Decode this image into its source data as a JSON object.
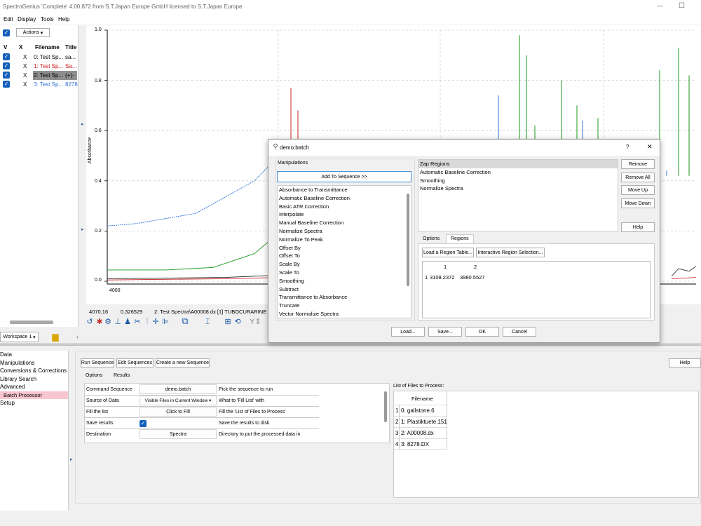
{
  "window": {
    "title": "SpectroGenius 'Complete' 4.00.872 from S.T.Japan Europe GmbH licensed to S.T.Japan Europe",
    "minimize_glyph": "—",
    "maximize_glyph": "☐"
  },
  "menu": [
    "Edit",
    "Display",
    "Tools",
    "Help"
  ],
  "spectra_list": {
    "actions_label": "Actions",
    "headers": {
      "v": "V",
      "x": "X",
      "filename": "Filename",
      "title": "Title"
    },
    "rows": [
      {
        "x": "X",
        "filename": "0: Test Sp...",
        "title": "sa...",
        "color": "#000000"
      },
      {
        "x": "X",
        "filename": "1: Test Sp...",
        "title": "Sa...",
        "color": "#cc2020"
      },
      {
        "x": "X",
        "filename": "2: Test Sp...",
        "title": "(+)-",
        "color": "#000000"
      },
      {
        "x": "X",
        "filename": "3: Test Sp...",
        "title": "8278",
        "color": "#2f6fdb"
      }
    ]
  },
  "plot": {
    "ylabel": "Absorbance",
    "y_ticks": [
      "1.0",
      "0.8",
      "0.6",
      "0.4",
      "0.2",
      "0.0"
    ],
    "x_tick": "4000",
    "status": {
      "x": "4070.16",
      "y": "0.326529",
      "file": "2: Test Spectra\\A00008.dx [1] TUBOCURARINE CH"
    }
  },
  "chart_data": {
    "type": "line",
    "title": "",
    "xlabel": "",
    "ylabel": "Absorbance",
    "x_ticks_visible": [
      "4000"
    ],
    "ylim": [
      0.0,
      1.0
    ],
    "y_ticks": [
      0.0,
      0.2,
      0.4,
      0.6,
      0.8,
      1.0
    ],
    "grid": true,
    "series": [
      {
        "color": "#2f6fdb",
        "points": [
          [
            0,
            0.22
          ],
          [
            5,
            0.23
          ],
          [
            15,
            0.27
          ],
          [
            25,
            0.4
          ],
          [
            30,
            0.52
          ],
          [
            35,
            0.5
          ],
          [
            45,
            0.46
          ],
          [
            55,
            0.43
          ],
          [
            62,
            0.4
          ]
        ]
      },
      {
        "color": "#1a9a1a",
        "points": [
          [
            0,
            0.045
          ],
          [
            10,
            0.045
          ],
          [
            18,
            0.055
          ],
          [
            25,
            0.11
          ],
          [
            32,
            0.25
          ],
          [
            36,
            0.32
          ],
          [
            40,
            0.28
          ],
          [
            48,
            0.16
          ],
          [
            62,
            0.07
          ]
        ]
      },
      {
        "color": "#cc2020",
        "points": [
          [
            0,
            0.005
          ],
          [
            20,
            0.01
          ],
          [
            40,
            0.02
          ],
          [
            55,
            0.015
          ],
          [
            62,
            0.01
          ]
        ]
      },
      {
        "color": "#222222",
        "points": [
          [
            0,
            0.01
          ],
          [
            20,
            0.015
          ],
          [
            35,
            0.03
          ],
          [
            45,
            0.028
          ],
          [
            62,
            0.02
          ]
        ]
      }
    ]
  },
  "toolbar_icons": [
    "undo-icon",
    "palette-icon",
    "gear-icon",
    "pin-icon",
    "people-icon",
    "cut-icon",
    "move-icon",
    "split-icon",
    "export-icon",
    "text-cursor-icon",
    "zoom-icon",
    "pan-icon"
  ],
  "workspace": {
    "tab": "Workspace 1",
    "add_glyph": "+"
  },
  "nav_tree": [
    "Data",
    "Manipulations",
    "Conversions & Corrections",
    "Library Search",
    "Advanced",
    "Batch Processor",
    "Setup"
  ],
  "batch_panel": {
    "run_label": "Run Sequence",
    "edit_label": "Edit Sequences",
    "create_label": "Create a new Sequence",
    "help_label": "Help",
    "tabs": [
      "Options",
      "Results"
    ],
    "options": [
      {
        "name": "Command Sequence",
        "value": "demo.batch",
        "desc": "Pick the sequence to run"
      },
      {
        "name": "Source of Data",
        "value": "Visible Files in Current Window",
        "desc": "What to 'Fill List' with"
      },
      {
        "name": "Fill the list",
        "value": "Click to Fill",
        "desc": "Fill the 'List of Files to Process'"
      },
      {
        "name": "Save results",
        "value": "",
        "desc": "Save the results to disk"
      },
      {
        "name": "Destination",
        "value": "Spectra",
        "desc": "Directory to put the processed data in"
      }
    ],
    "files_title": "List of Files to Process:",
    "files_header": "Filename",
    "files": [
      {
        "n": "1",
        "name": "0: gallstone.6"
      },
      {
        "n": "2",
        "name": "1: Plastiktuete.151"
      },
      {
        "n": "3",
        "name": "2: A00008.dx"
      },
      {
        "n": "4",
        "name": "3: 8278.DX"
      }
    ]
  },
  "dialog": {
    "title": "demo.batch",
    "help_glyph": "?",
    "close_glyph": "✕",
    "manipulations_label": "Manipulations",
    "add_label": "Add To Sequence >>",
    "manipulations": [
      "Absorbance to Transmittance",
      "Automatic Baseline Correction",
      "Basic ATR Correction",
      "Interpolate",
      "Manual Baseline Correction",
      "Normalize Spectra",
      "Normalize To Peak",
      "Offset By",
      "Offset To",
      "Scale By",
      "Scale To",
      "Smoothing",
      "Subtract",
      "Transmittance to Absorbance",
      "Truncate",
      "Vector Normalize Spectra"
    ],
    "sequence": [
      "Zap Regions",
      "Automatic Baseline Correction",
      "Smoothing",
      "Normalize Spectra"
    ],
    "side_buttons": [
      "Remove",
      "Remove All",
      "Move Up",
      "Move Down",
      "Help"
    ],
    "tabs": [
      "Options",
      "Regions"
    ],
    "load_region": "Load a Region Table...",
    "interactive_region": "Interactive Region Selection...",
    "region_cols": [
      "1",
      "2"
    ],
    "region_row": {
      "n": "1",
      "c1": "3108.2372",
      "c2": "3980.5527"
    },
    "bottom_buttons": {
      "load": "Load...",
      "save": "Save...",
      "ok": "OK",
      "cancel": "Cancel"
    }
  }
}
